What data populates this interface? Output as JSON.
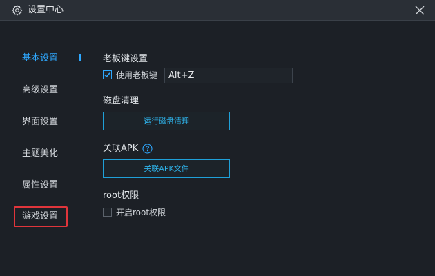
{
  "window": {
    "title": "设置中心"
  },
  "sidebar": {
    "items": [
      {
        "label": "基本设置"
      },
      {
        "label": "高级设置"
      },
      {
        "label": "界面设置"
      },
      {
        "label": "主题美化"
      },
      {
        "label": "属性设置"
      },
      {
        "label": "游戏设置"
      }
    ]
  },
  "boss_key": {
    "title": "老板键设置",
    "checkbox_label": "使用老板键",
    "checked": true,
    "hotkey_value": "Alt+Z"
  },
  "disk_clean": {
    "title": "磁盘清理",
    "button_label": "运行磁盘清理"
  },
  "apk": {
    "title": "关联APK",
    "button_label": "关联APK文件"
  },
  "root": {
    "title": "root权限",
    "checkbox_label": "开启root权限",
    "checked": false
  },
  "colors": {
    "accent": "#2ea8ff",
    "highlight_border": "#e0353b",
    "background": "#1c2026"
  },
  "icons": {
    "title": "gear-icon",
    "close": "close-icon",
    "help": "help-icon",
    "check": "check-icon"
  }
}
